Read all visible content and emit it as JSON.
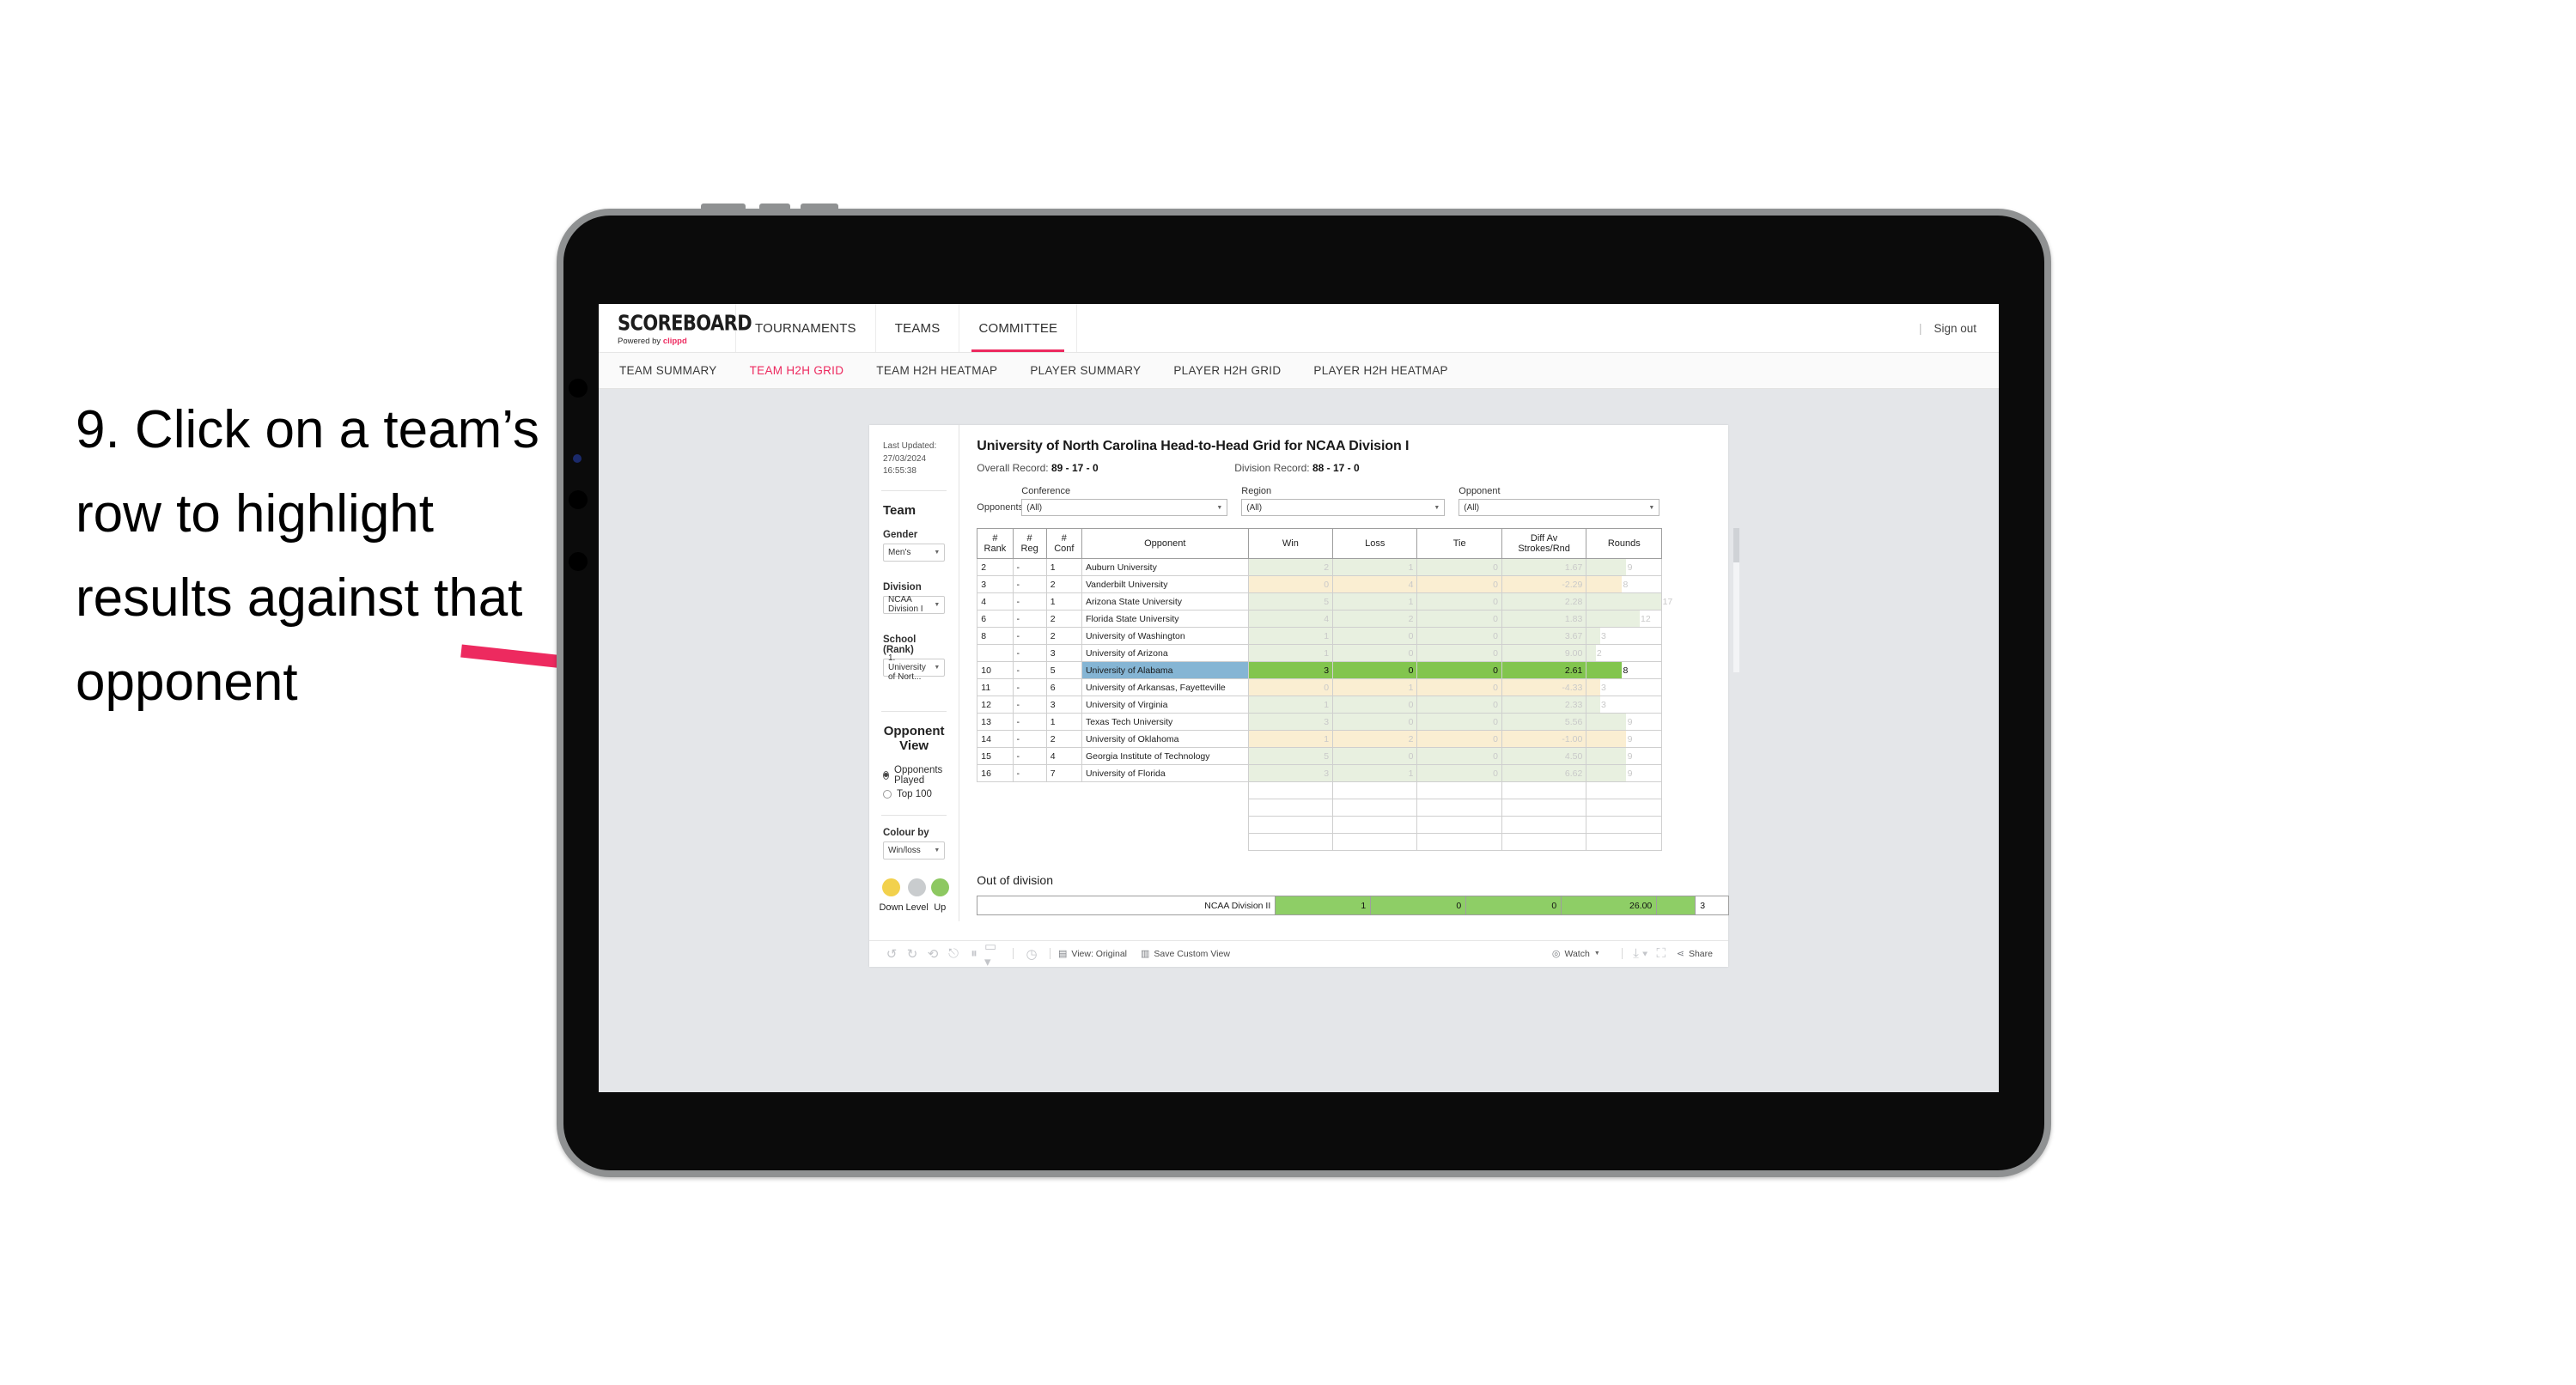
{
  "annotation": {
    "text": "9. Click on a team’s row to highlight results against that opponent",
    "arrow_color": "#ED2A5F"
  },
  "app": {
    "brand": {
      "name": "SCOREBOARD",
      "powered_prefix": "Powered by ",
      "powered_by": "clippd"
    },
    "top_nav": [
      {
        "label": "TOURNAMENTS",
        "active": false
      },
      {
        "label": "TEAMS",
        "active": false
      },
      {
        "label": "COMMITTEE",
        "active": true
      }
    ],
    "sign_out": "Sign out",
    "divider": "|",
    "sub_nav": [
      {
        "label": "TEAM SUMMARY",
        "active": false
      },
      {
        "label": "TEAM H2H GRID",
        "active": true
      },
      {
        "label": "TEAM H2H HEATMAP",
        "active": false
      },
      {
        "label": "PLAYER SUMMARY",
        "active": false
      },
      {
        "label": "PLAYER H2H GRID",
        "active": false
      },
      {
        "label": "PLAYER H2H HEATMAP",
        "active": false
      }
    ]
  },
  "sidebar": {
    "last_updated": "Last Updated: 27/03/2024 16:55:38",
    "team_heading": "Team",
    "gender_label": "Gender",
    "gender_value": "Men's",
    "division_label": "Division",
    "division_value": "NCAA Division I",
    "school_label": "School (Rank)",
    "school_value": "1. University of Nort...",
    "opponent_view_heading": "Opponent View",
    "opponent_view_options": [
      {
        "label": "Opponents Played",
        "selected": true
      },
      {
        "label": "Top 100",
        "selected": false
      }
    ],
    "colour_by_label": "Colour by",
    "colour_by_value": "Win/loss",
    "legend": [
      {
        "label": "Down",
        "color": "#F2D14C"
      },
      {
        "label": "Level",
        "color": "#C9CCCE"
      },
      {
        "label": "Up",
        "color": "#8DC861"
      }
    ]
  },
  "main": {
    "title": "University of North Carolina Head-to-Head Grid for NCAA Division I",
    "overall_record_label": "Overall Record: ",
    "overall_record_value": "89 - 17 - 0",
    "division_record_label": "Division Record: ",
    "division_record_value": "88 - 17 - 0",
    "filters_lead": "Opponents:",
    "filters": [
      {
        "caption": "Conference",
        "value": "(All)"
      },
      {
        "caption": "Region",
        "value": "(All)"
      },
      {
        "caption": "Opponent",
        "value": "(All)"
      }
    ],
    "table": {
      "columns": [
        "# Rank",
        "# Reg",
        "# Conf",
        "Opponent",
        "Win",
        "Loss",
        "Tie",
        "Diff Av Strokes/Rnd",
        "Rounds"
      ],
      "column_lines": {
        "rank": [
          "#",
          "Rank"
        ],
        "reg": [
          "#",
          "Reg"
        ],
        "conf": [
          "#",
          "Conf"
        ],
        "diff": [
          "Diff Av",
          "Strokes/Rnd"
        ]
      },
      "rows": [
        {
          "rank": "2",
          "reg": "-",
          "conf": "1",
          "opponent": "Auburn University",
          "win": "2",
          "loss": "1",
          "tie": "0",
          "diff": "1.67",
          "rounds": "9",
          "tone": "up",
          "selected": false
        },
        {
          "rank": "3",
          "reg": "-",
          "conf": "2",
          "opponent": "Vanderbilt University",
          "win": "0",
          "loss": "4",
          "tie": "0",
          "diff": "-2.29",
          "rounds": "8",
          "tone": "down",
          "selected": false
        },
        {
          "rank": "4",
          "reg": "-",
          "conf": "1",
          "opponent": "Arizona State University",
          "win": "5",
          "loss": "1",
          "tie": "0",
          "diff": "2.28",
          "rounds": "17",
          "tone": "up",
          "selected": false
        },
        {
          "rank": "6",
          "reg": "-",
          "conf": "2",
          "opponent": "Florida State University",
          "win": "4",
          "loss": "2",
          "tie": "0",
          "diff": "1.83",
          "rounds": "12",
          "tone": "up",
          "selected": false
        },
        {
          "rank": "8",
          "reg": "-",
          "conf": "2",
          "opponent": "University of Washington",
          "win": "1",
          "loss": "0",
          "tie": "0",
          "diff": "3.67",
          "rounds": "3",
          "tone": "up",
          "selected": false
        },
        {
          "rank": "",
          "reg": "-",
          "conf": "3",
          "opponent": "University of Arizona",
          "win": "1",
          "loss": "0",
          "tie": "0",
          "diff": "9.00",
          "rounds": "2",
          "tone": "up",
          "selected": false
        },
        {
          "rank": "10",
          "reg": "-",
          "conf": "5",
          "opponent": "University of Alabama",
          "win": "3",
          "loss": "0",
          "tie": "0",
          "diff": "2.61",
          "rounds": "8",
          "tone": "up",
          "selected": true
        },
        {
          "rank": "11",
          "reg": "-",
          "conf": "6",
          "opponent": "University of Arkansas, Fayetteville",
          "win": "0",
          "loss": "1",
          "tie": "0",
          "diff": "-4.33",
          "rounds": "3",
          "tone": "down",
          "selected": false
        },
        {
          "rank": "12",
          "reg": "-",
          "conf": "3",
          "opponent": "University of Virginia",
          "win": "1",
          "loss": "0",
          "tie": "0",
          "diff": "2.33",
          "rounds": "3",
          "tone": "up",
          "selected": false
        },
        {
          "rank": "13",
          "reg": "-",
          "conf": "1",
          "opponent": "Texas Tech University",
          "win": "3",
          "loss": "0",
          "tie": "0",
          "diff": "5.56",
          "rounds": "9",
          "tone": "up",
          "selected": false
        },
        {
          "rank": "14",
          "reg": "-",
          "conf": "2",
          "opponent": "University of Oklahoma",
          "win": "1",
          "loss": "2",
          "tie": "0",
          "diff": "-1.00",
          "rounds": "9",
          "tone": "down",
          "selected": false
        },
        {
          "rank": "15",
          "reg": "-",
          "conf": "4",
          "opponent": "Georgia Institute of Technology",
          "win": "5",
          "loss": "0",
          "tie": "0",
          "diff": "4.50",
          "rounds": "9",
          "tone": "up",
          "selected": false
        },
        {
          "rank": "16",
          "reg": "-",
          "conf": "7",
          "opponent": "University of Florida",
          "win": "3",
          "loss": "1",
          "tie": "0",
          "diff": "6.62",
          "rounds": "9",
          "tone": "up",
          "selected": false
        }
      ]
    },
    "out_of_division": {
      "heading": "Out of division",
      "row": {
        "label": "NCAA Division II",
        "win": "1",
        "loss": "0",
        "tie": "0",
        "diff": "26.00",
        "rounds": "3"
      }
    }
  },
  "toolbar": {
    "icons": [
      "undo-icon",
      "redo-icon",
      "revert-icon",
      "refresh-icon",
      "pause-icon",
      "alerts-icon",
      "dashboard-icon"
    ],
    "view_original": "View: Original",
    "save_custom_view": "Save Custom View",
    "watch": "Watch",
    "share": "Share"
  },
  "chart_data": {
    "type": "table",
    "title": "University of North Carolina Head-to-Head Grid for NCAA Division I",
    "categories": [
      "Auburn University",
      "Vanderbilt University",
      "Arizona State University",
      "Florida State University",
      "University of Washington",
      "University of Arizona",
      "University of Alabama",
      "University of Arkansas, Fayetteville",
      "University of Virginia",
      "Texas Tech University",
      "University of Oklahoma",
      "Georgia Institute of Technology",
      "University of Florida",
      "NCAA Division II"
    ],
    "series": [
      {
        "name": "Win",
        "values": [
          2,
          0,
          5,
          4,
          1,
          1,
          3,
          0,
          1,
          3,
          1,
          5,
          3,
          1
        ]
      },
      {
        "name": "Loss",
        "values": [
          1,
          4,
          1,
          2,
          0,
          0,
          0,
          1,
          0,
          0,
          2,
          0,
          1,
          0
        ]
      },
      {
        "name": "Tie",
        "values": [
          0,
          0,
          0,
          0,
          0,
          0,
          0,
          0,
          0,
          0,
          0,
          0,
          0,
          0
        ]
      },
      {
        "name": "Diff Av Strokes/Rnd",
        "values": [
          1.67,
          -2.29,
          2.28,
          1.83,
          3.67,
          9.0,
          2.61,
          -4.33,
          2.33,
          5.56,
          -1.0,
          4.5,
          6.62,
          26.0
        ]
      },
      {
        "name": "Rounds",
        "values": [
          9,
          8,
          17,
          12,
          3,
          2,
          8,
          3,
          3,
          9,
          9,
          9,
          9,
          3
        ]
      }
    ],
    "legend": [
      "Down",
      "Level",
      "Up"
    ]
  }
}
